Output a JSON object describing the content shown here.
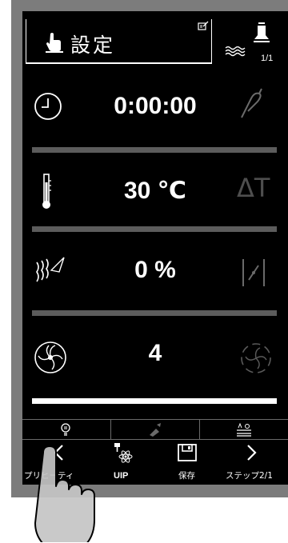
{
  "header": {
    "title": "設定",
    "alarm_count": "1/1"
  },
  "rows": [
    {
      "value": "0:00:00",
      "left_icon": "clock-icon",
      "right_icon": "core-probe-icon"
    },
    {
      "value": "30 ℃",
      "left_icon": "thermometer-icon",
      "right_icon": "delta-t-icon",
      "right_text": "ΔT"
    },
    {
      "value": "0 %",
      "left_icon": "steam-icon",
      "right_icon": "damper-icon"
    },
    {
      "value": "4",
      "left_icon": "fan-icon",
      "right_icon": "fan-speed-icon"
    }
  ],
  "tabs": [
    "tip-icon",
    "cleaning-icon",
    "settings-levels-icon"
  ],
  "nav": {
    "prev_label": "プリヒーティ",
    "uip_label": "UIP",
    "save_label": "保存",
    "next_label": "ステップ2/1"
  },
  "colors": {
    "background": "#000000",
    "text": "#ffffff",
    "separator": "#5c5c5c",
    "frame": "#7c7c7c"
  }
}
